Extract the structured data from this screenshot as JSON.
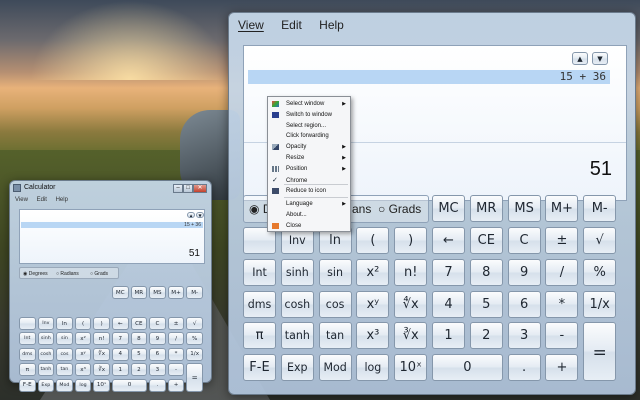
{
  "big": {
    "menu": [
      "View",
      "Edit",
      "Help"
    ],
    "history_expr": "15  +  36",
    "result": "51",
    "mode_partial_d": "D",
    "mode_partial_radians": "ans",
    "mode_grads": "Grads",
    "rows": [
      [
        "Inv",
        "ln",
        "(",
        ")",
        "←",
        "CE",
        "C",
        "±",
        "√"
      ],
      [
        "Int",
        "sinh",
        "sin",
        "x²",
        "n!",
        "7",
        "8",
        "9",
        "/",
        "%"
      ],
      [
        "dms",
        "cosh",
        "cos",
        "xʸ",
        "∜x",
        "4",
        "5",
        "6",
        "*",
        "1/x"
      ],
      [
        "π",
        "tanh",
        "tan",
        "x³",
        "∛x",
        "1",
        "2",
        "3",
        "-"
      ],
      [
        "F-E",
        "Exp",
        "Mod",
        "log",
        "10ˣ",
        "0",
        ".",
        "+"
      ]
    ],
    "memory": [
      "MC",
      "MR",
      "MS",
      "M+",
      "M-"
    ],
    "equals": "="
  },
  "small": {
    "title": "Calculator",
    "menu": [
      "View",
      "Edit",
      "Help"
    ],
    "history_expr": "15  +  36",
    "result": "51",
    "modes": [
      "Degrees",
      "Radians",
      "Grads"
    ],
    "memory": [
      "MC",
      "MR",
      "MS",
      "M+",
      "M-"
    ],
    "rows": [
      [
        "Inv",
        "ln",
        "(",
        ")",
        "←",
        "CE",
        "C",
        "±",
        "√"
      ],
      [
        "Int",
        "sinh",
        "sin",
        "x²",
        "n!",
        "7",
        "8",
        "9",
        "/",
        "%"
      ],
      [
        "dms",
        "cosh",
        "cos",
        "xʸ",
        "∜x",
        "4",
        "5",
        "6",
        "*",
        "1/x"
      ],
      [
        "π",
        "tanh",
        "tan",
        "x³",
        "∛x",
        "1",
        "2",
        "3",
        "-"
      ],
      [
        "F-E",
        "Exp",
        "Mod",
        "log",
        "10ˣ",
        "0",
        ".",
        "+"
      ]
    ],
    "equals": "="
  },
  "context_menu": [
    {
      "label": "Select window",
      "sub": true,
      "icon": "select-window-icon"
    },
    {
      "label": "Switch to window",
      "sub": false,
      "icon": "switch-window-icon"
    },
    {
      "label": "Select region...",
      "sub": false,
      "icon": ""
    },
    {
      "label": "Click forwarding",
      "sub": false,
      "icon": ""
    },
    {
      "label": "Opacity",
      "sub": true,
      "icon": "opacity-icon"
    },
    {
      "label": "Resize",
      "sub": true,
      "icon": ""
    },
    {
      "label": "Position",
      "sub": true,
      "icon": "position-icon"
    },
    {
      "label": "Chrome",
      "sub": false,
      "icon": "check-icon"
    },
    {
      "label": "Reduce to icon",
      "sub": false,
      "icon": "reduce-icon"
    },
    {
      "label": "Language",
      "sub": true,
      "icon": ""
    },
    {
      "label": "About...",
      "sub": false,
      "icon": ""
    },
    {
      "label": "Close",
      "sub": false,
      "icon": "close-icon"
    }
  ]
}
